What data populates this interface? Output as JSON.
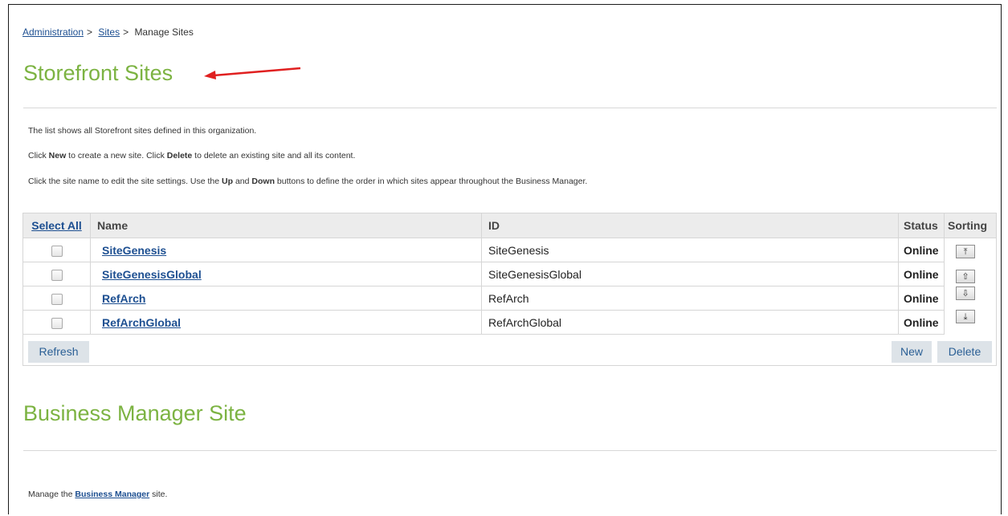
{
  "breadcrumb": {
    "items": [
      "Administration",
      "Sites",
      "Manage Sites"
    ],
    "separator": ">"
  },
  "storefront": {
    "title": "Storefront Sites",
    "intro": "The list shows all Storefront sites defined in this organization.",
    "line2": {
      "pre": "Click ",
      "new_word": "New",
      "mid": " to create a new site. Click ",
      "delete_word": "Delete",
      "post": " to delete an existing site and all its content."
    },
    "line3": {
      "pre": "Click the site name to edit the site settings. Use the ",
      "up_word": "Up",
      "mid": " and ",
      "down_word": "Down",
      "post": " buttons to define the order in which sites appear throughout the Business Manager."
    },
    "table": {
      "headers": {
        "select_all": "Select All",
        "name": "Name",
        "id": "ID",
        "status": "Status",
        "sorting": "Sorting"
      },
      "rows": [
        {
          "name": "SiteGenesis",
          "id": "SiteGenesis",
          "status": "Online",
          "checked": false
        },
        {
          "name": "SiteGenesisGlobal",
          "id": "SiteGenesisGlobal",
          "status": "Online",
          "checked": false
        },
        {
          "name": "RefArch",
          "id": "RefArch",
          "status": "Online",
          "checked": false
        },
        {
          "name": "RefArchGlobal",
          "id": "RefArchGlobal",
          "status": "Online",
          "checked": false
        }
      ],
      "sort_buttons": {
        "top": "⤒",
        "up": "⇧",
        "down": "⇩",
        "bottom": "⤓"
      }
    },
    "buttons": {
      "refresh": "Refresh",
      "new": "New",
      "delete": "Delete"
    }
  },
  "business_manager": {
    "title": "Business Manager Site",
    "text_pre": "Manage the ",
    "link": "Business Manager",
    "text_post": " site."
  },
  "colors": {
    "title_green": "#7cb342",
    "link_blue": "#1d4f91",
    "arrow_red": "#e02020",
    "button_bg": "#dde3e8"
  }
}
